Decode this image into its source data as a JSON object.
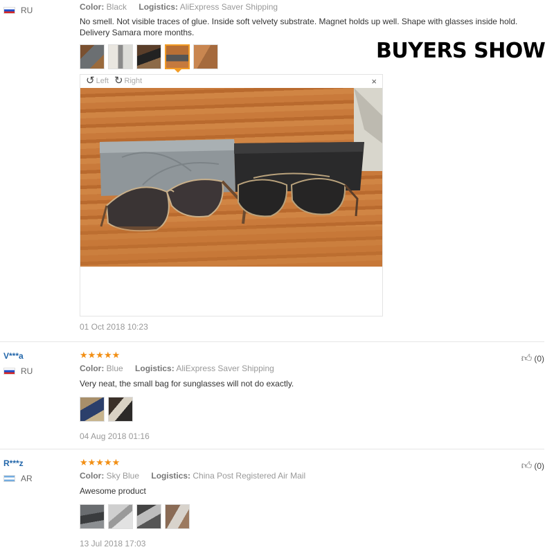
{
  "banner": "BUYERS SHOW",
  "reviews": [
    {
      "country": "RU",
      "meta": {
        "color_key": "Color:",
        "color": "Black",
        "logistics_key": "Logistics:",
        "logistics": "AliExpress Saver Shipping"
      },
      "text": "No smell. Not visible traces of glue. Inside soft velvety substrate. Magnet holds up well. Shape with glasses inside hold. Delivery Samara more months.",
      "viewer": {
        "left": "Left",
        "right": "Right",
        "close": "×"
      },
      "date": "01 Oct 2018 10:23"
    },
    {
      "user": "V***a",
      "country": "RU",
      "stars": "★★★★★",
      "meta": {
        "color_key": "Color:",
        "color": "Blue",
        "logistics_key": "Logistics:",
        "logistics": "AliExpress Saver Shipping"
      },
      "text": "Very neat, the small bag for sunglasses will not do exactly.",
      "date": "04 Aug 2018 01:16",
      "likes": "(0)"
    },
    {
      "user": "R***z",
      "country": "AR",
      "stars": "★★★★★",
      "meta": {
        "color_key": "Color:",
        "color": "Sky Blue",
        "logistics_key": "Logistics:",
        "logistics": "China Post Registered Air Mail"
      },
      "text": "Awesome product",
      "date": "13 Jul 2018 17:03",
      "likes": "(0)"
    }
  ],
  "colors": {
    "username": "#2266aa",
    "stars": "#f28f14",
    "active_thumb": "#f29c26"
  }
}
